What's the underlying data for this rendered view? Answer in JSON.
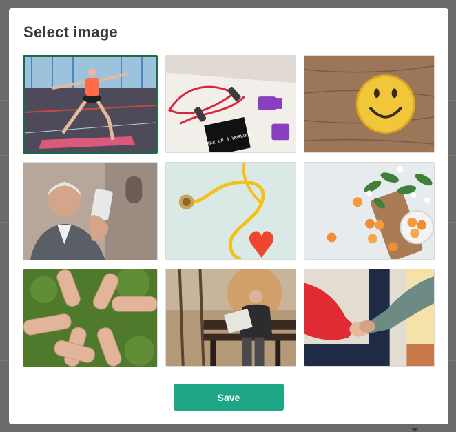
{
  "dialog": {
    "title": "Select image",
    "save_label": "Save"
  },
  "images": [
    {
      "name": "yoga-man",
      "selected": true
    },
    {
      "name": "workout-items",
      "text": "WAKE UP & WORKOUT",
      "selected": false
    },
    {
      "name": "smiley-cookie",
      "selected": false
    },
    {
      "name": "older-man-phone",
      "selected": false
    },
    {
      "name": "stethoscope-heart",
      "selected": false
    },
    {
      "name": "apricots-board",
      "selected": false
    },
    {
      "name": "hands-circle",
      "selected": false
    },
    {
      "name": "man-bench-newspaper",
      "selected": false
    },
    {
      "name": "holding-hands",
      "selected": false
    }
  ],
  "colors": {
    "accent": "#1ea786",
    "selected_border": "#1e6b4a"
  }
}
